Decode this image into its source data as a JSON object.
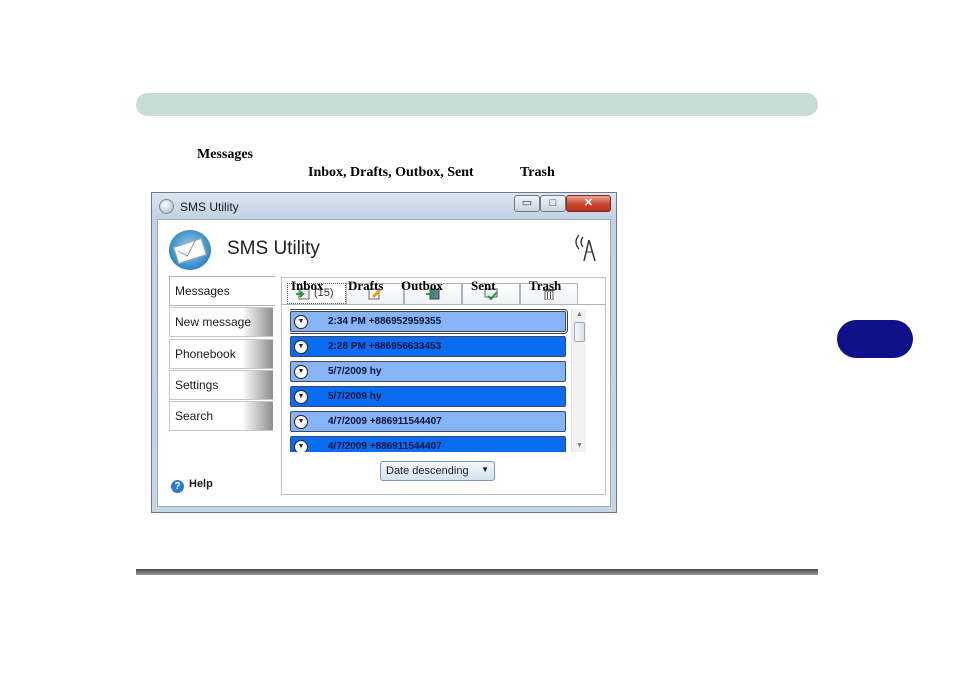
{
  "doc": {
    "caption_line1": "Messages",
    "caption_line2_part1": "Inbox, Drafts, Outbox, Sent",
    "caption_line2_part2": "Trash"
  },
  "window": {
    "title": "SMS Utility",
    "controls": {
      "minimize": "▭",
      "maximize": "□",
      "close": "✕"
    }
  },
  "app": {
    "heading": "SMS Utility",
    "logo_icon": "envelope-globe-icon",
    "signal_icon": "antenna-signal-icon"
  },
  "sidebar": {
    "items": [
      {
        "label": "Messages",
        "active": true
      },
      {
        "label": "New message",
        "active": false
      },
      {
        "label": "Phonebook",
        "active": false
      },
      {
        "label": "Settings",
        "active": false
      },
      {
        "label": "Search",
        "active": false
      }
    ],
    "help": {
      "label": "Help",
      "icon_glyph": "?"
    }
  },
  "tab_captions": [
    "Inbox",
    "Drafts",
    "Outbox",
    "Sent",
    "Trash"
  ],
  "tabs": [
    {
      "name": "inbox",
      "icon": "inbox-icon",
      "count": "(15)",
      "selected": true
    },
    {
      "name": "drafts",
      "icon": "drafts-icon",
      "count": "",
      "selected": false
    },
    {
      "name": "outbox",
      "icon": "outbox-icon",
      "count": "",
      "selected": false
    },
    {
      "name": "sent",
      "icon": "sent-icon",
      "count": "",
      "selected": false
    },
    {
      "name": "trash",
      "icon": "trash-icon",
      "count": "",
      "selected": false
    }
  ],
  "messages": [
    {
      "text": "2:34 PM  +886952959355",
      "style": "light",
      "selected": true
    },
    {
      "text": "2:28 PM  +886956633453",
      "style": "dark",
      "selected": false
    },
    {
      "text": "5/7/2009  hy",
      "style": "light",
      "selected": false
    },
    {
      "text": "5/7/2009  hy",
      "style": "dark",
      "selected": false
    },
    {
      "text": "4/7/2009  +886911544407",
      "style": "light",
      "selected": false
    },
    {
      "text": "4/7/2009  +886911544407",
      "style": "dark",
      "selected": false
    }
  ],
  "message_toggle_glyph": "▼",
  "scrollbar": {
    "up": "▲",
    "down": "▼"
  },
  "sort": {
    "value": "Date descending",
    "arrow": "▼"
  },
  "colors": {
    "header_bar": "#c8dcd6",
    "chapter_badge": "#101088",
    "message_light": "#86b4f5",
    "message_dark": "#0a6cf0",
    "close_button": "#c9452c"
  }
}
